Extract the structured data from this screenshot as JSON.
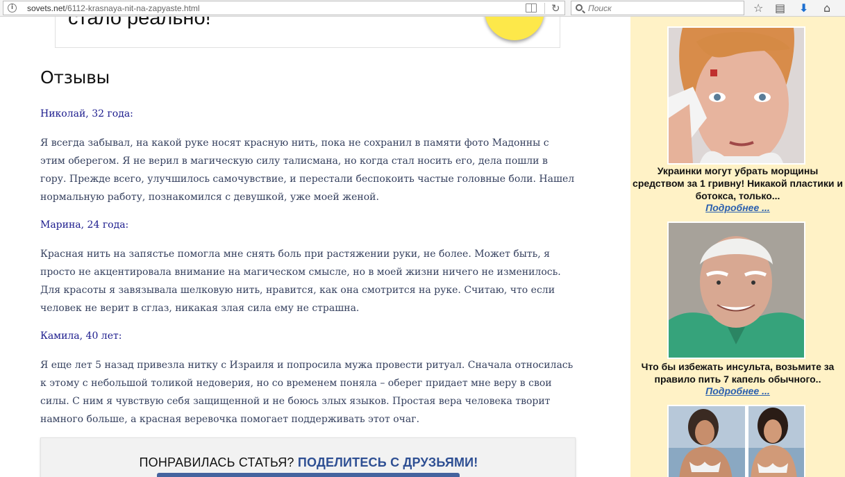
{
  "browser": {
    "url_host": "sovets.net",
    "url_path": "/6112-krasnaya-nit-na-zapyaste.html",
    "search_placeholder": "Поиск",
    "icons": [
      "info-icon",
      "reader-view-icon",
      "reload-icon",
      "search-icon",
      "bookmark-star-icon",
      "reading-list-icon",
      "download-icon",
      "home-icon"
    ]
  },
  "banner": {
    "text": "стало реально!"
  },
  "section": {
    "title": "Отзывы",
    "reviews": [
      {
        "name": "Николай, 32 года:",
        "text": "Я всегда забывал, на какой руке носят красную нить, пока не сохранил в памяти фото Мадонны с этим оберегом. Я не верил в магическую силу талисмана, но когда стал носить его, дела пошли в гору. Прежде всего, улучшилось самочувствие, и перестали беспокоить частые головные боли. Нашел нормальную работу, познакомился с девушкой, уже моей женой."
      },
      {
        "name": "Марина, 24 года:",
        "text": "Красная нить на запястье помогла мне снять боль при растяжении руки, не более. Может быть, я просто не акцентировала внимание на магическом смысле, но в моей жизни ничего не изменилось. Для красоты я завязывала шелковую нить, нравится, как она смотрится на руке. Считаю, что если человек не верит в сглаз, никакая злая сила ему не страшна."
      },
      {
        "name": "Камила, 40 лет:",
        "text": "Я еще лет 5 назад привезла нитку с Израиля и попросила мужа провести ритуал. Сначала относилась к этому с небольшой толикой недоверия, но со временем поняла – оберег придает мне веру в свои силы. С ним я чувствую себя защищенной и не боюсь злых языков. Простая вера человека творит намного больше, а красная веревочка помогает поддерживать этот очаг."
      }
    ]
  },
  "share": {
    "prefix": "ПОНРАВИЛАСЬ СТАТЬЯ?",
    "accent": "ПОДЕЛИТЕСЬ С ДРУЗЬЯМИ!"
  },
  "sidebar": {
    "ads": [
      {
        "title": "Украинки могут убрать морщины средством за 1 гривну! Никакой пластики и ботокса, только...",
        "link": "Подробнее ..."
      },
      {
        "title": "Что бы избежать инсульта, возьмите за правило пить 7 капель обычного..",
        "link": "Подробнее ..."
      }
    ]
  },
  "colors": {
    "sidebar_bg": "#fff2c6",
    "review_name": "#1a1a8c",
    "review_text": "#35405e",
    "share_accent": "#2e4f93",
    "ad_link": "#2a5fae",
    "share_button": "#44639e"
  }
}
